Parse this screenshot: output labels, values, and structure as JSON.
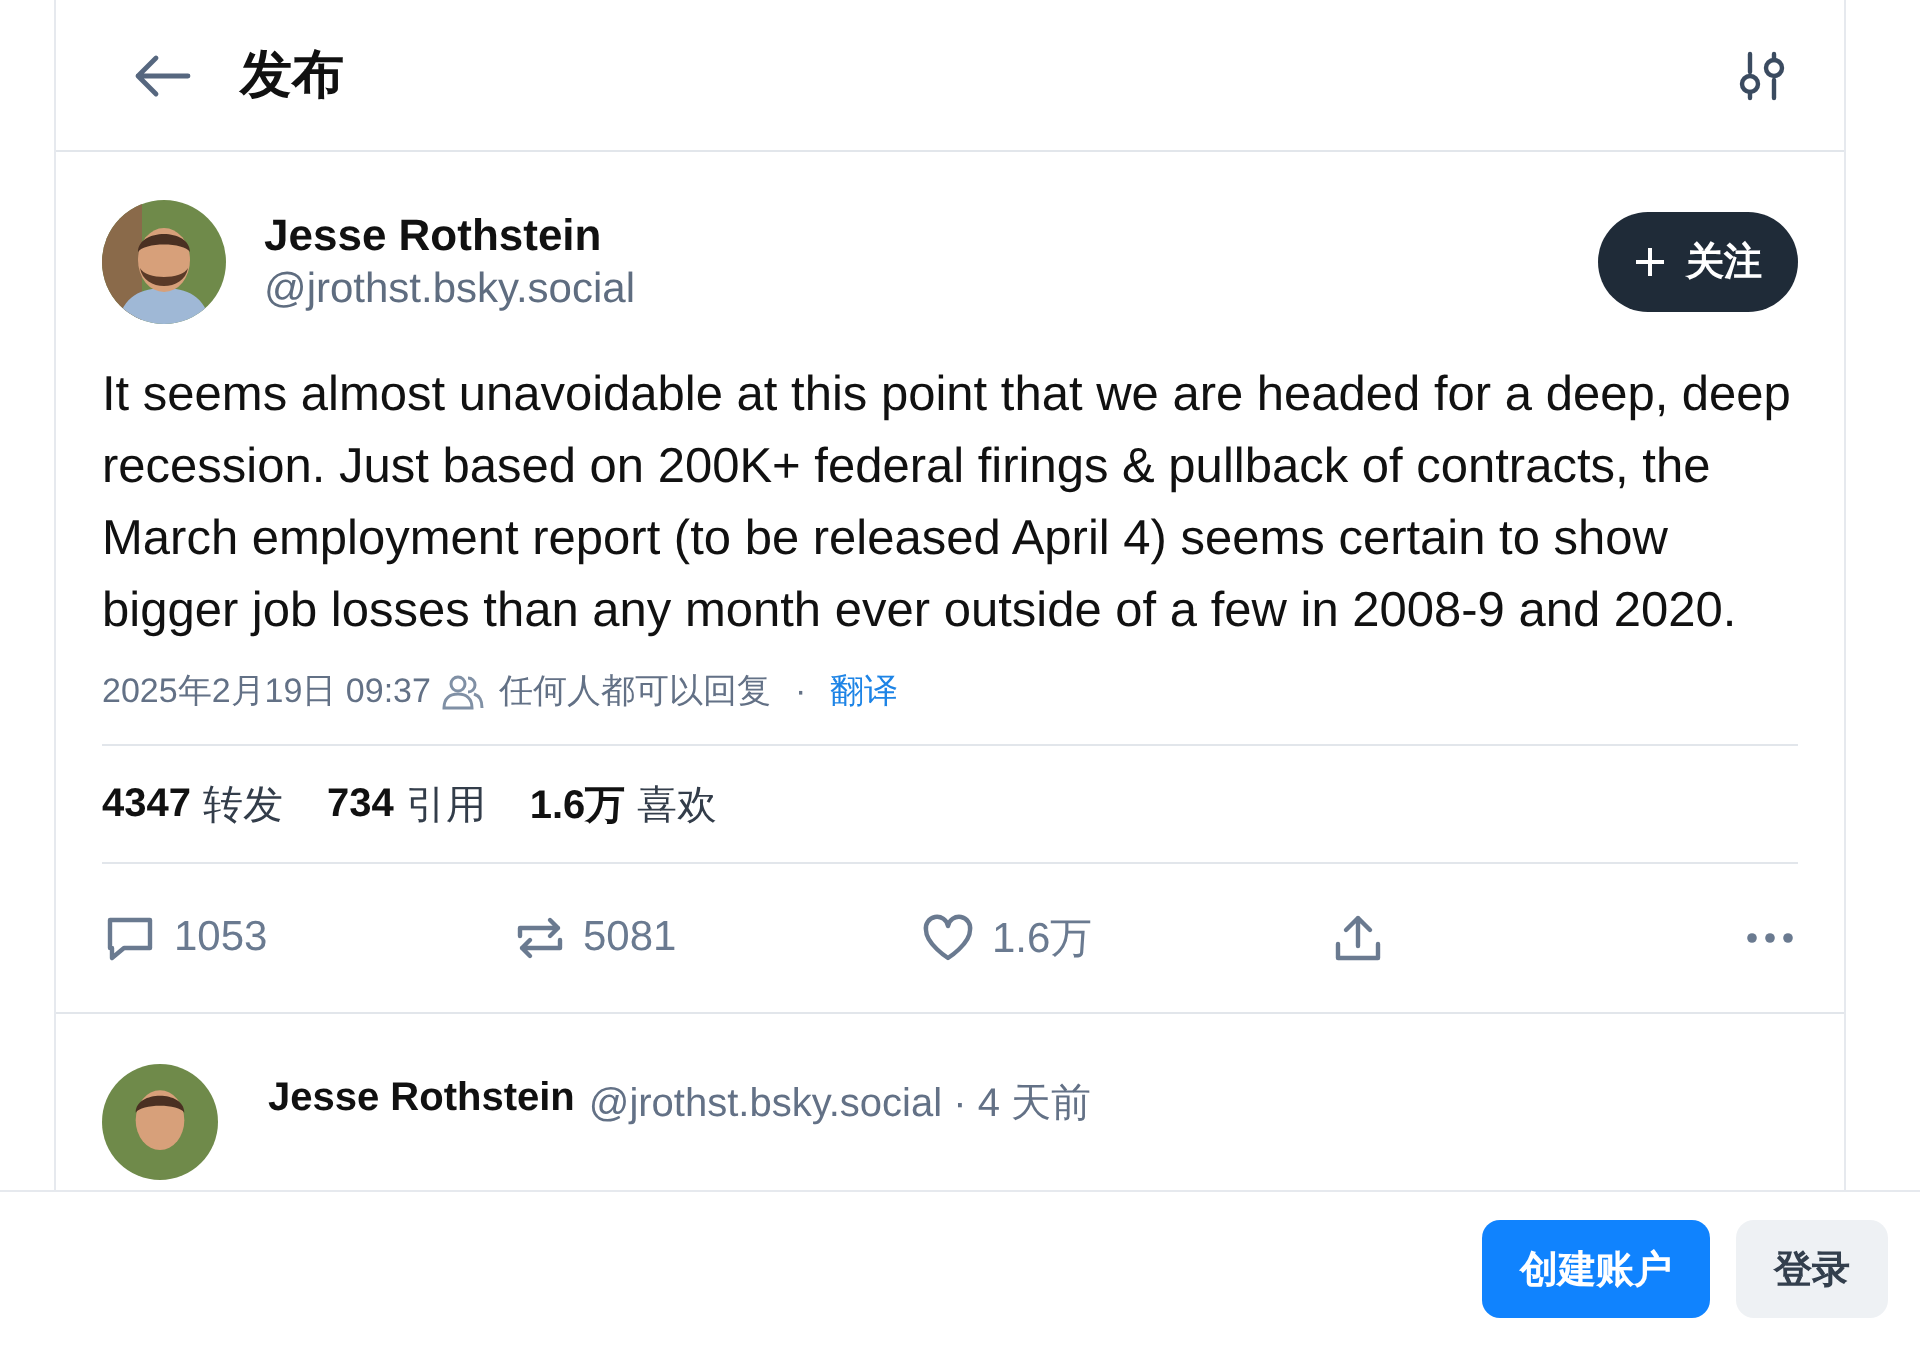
{
  "header": {
    "title": "发布"
  },
  "post": {
    "author": "Jesse Rothstein",
    "handle": "@jrothst.bsky.social",
    "follow": "关注",
    "text": "It seems almost unavoidable at this point that we are headed for a deep, deep recession. Just based on 200K+ federal firings & pullback of contracts, the March employment report (to be released April 4) seems certain to show bigger job losses than any month ever outside of a few in 2008-9 and 2020.",
    "timestamp": "2025年2月19日 09:37",
    "reply_setting": "任何人都可以回复",
    "separator": "·",
    "translate": "翻译",
    "stats": [
      {
        "count": "4347",
        "label": "转发"
      },
      {
        "count": "734",
        "label": "引用"
      },
      {
        "count": "1.6万",
        "label": "喜欢"
      }
    ],
    "actions": [
      {
        "kind": "reply",
        "count": "1053"
      },
      {
        "kind": "repost",
        "count": "5081"
      },
      {
        "kind": "like",
        "count": "1.6万"
      },
      {
        "kind": "share"
      },
      {
        "kind": "more"
      }
    ]
  },
  "reply": {
    "author": "Jesse Rothstein",
    "meta": "@jrothst.bsky.social · 4 天前"
  },
  "bottom_bar": {
    "buttons": [
      {
        "label": "创建账户",
        "kind": "primary"
      },
      {
        "label": "登录",
        "kind": "secondary"
      }
    ]
  }
}
